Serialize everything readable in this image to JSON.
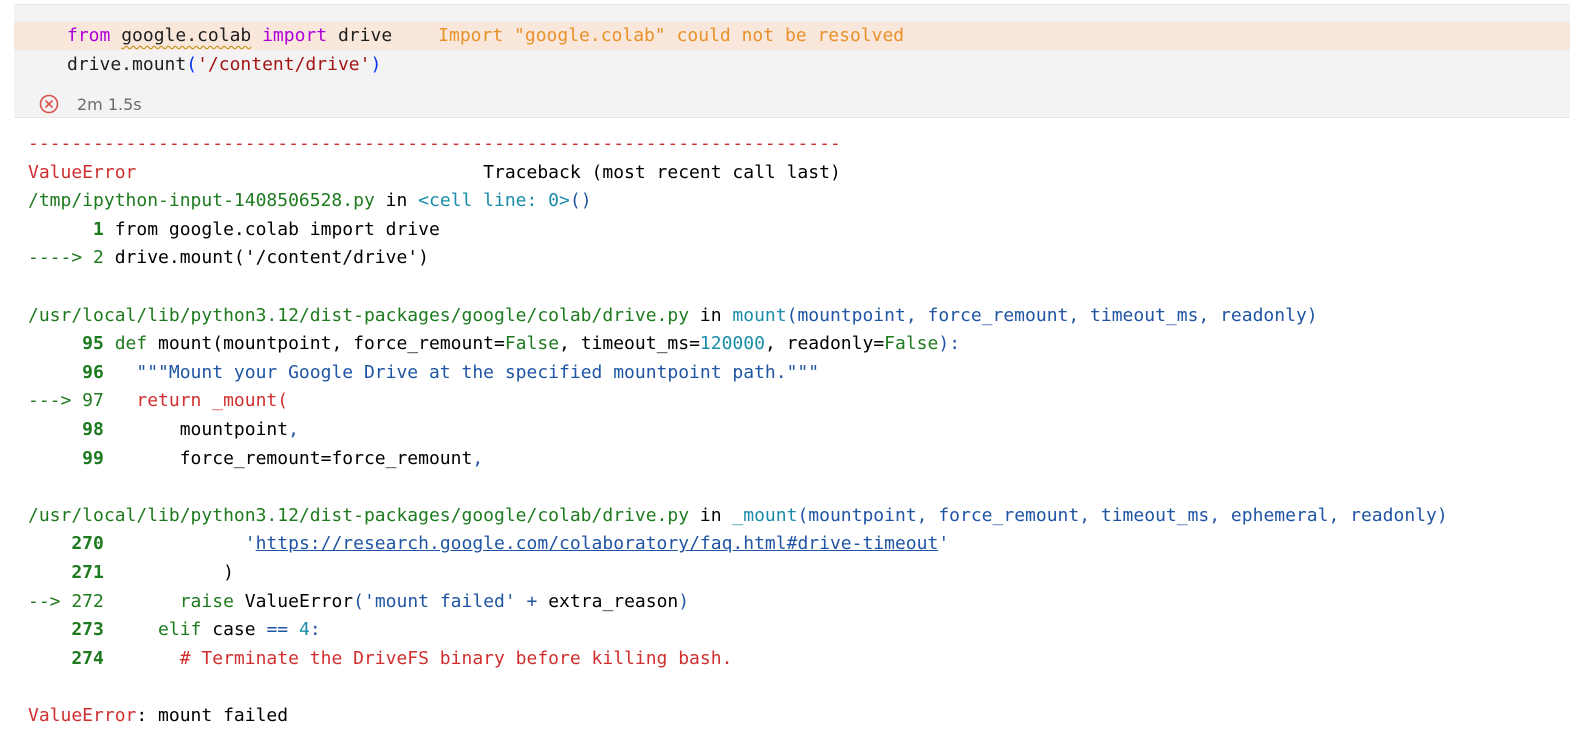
{
  "cell": {
    "line1": {
      "kw_from": "from",
      "module": "google.colab",
      "kw_import": "import",
      "name": "drive",
      "diagnostic": "Import \"google.colab\" could not be resolved"
    },
    "line2": {
      "call": "drive.mount",
      "paren_open": "(",
      "arg": "'/content/drive'",
      "paren_close": ")"
    },
    "status": {
      "icon": "error-circle-icon",
      "duration": "2m 1.5s"
    }
  },
  "output": {
    "separator": "---------------------------------------------------------------------------",
    "header": {
      "error": "ValueError",
      "traceback": "Traceback (most recent call last)"
    },
    "frame1": {
      "path": "/tmp/ipython-input-1408506528.py",
      "in_word": " in ",
      "location": "<cell line: 0>",
      "loc_parens": "()",
      "lines": [
        {
          "marker": "      1 ",
          "text": "from google.colab import drive"
        },
        {
          "marker": "----> 2 ",
          "text": "drive.mount('/content/drive')"
        }
      ]
    },
    "frame2": {
      "path": "/usr/local/lib/python3.12/dist-packages/google/colab/drive.py",
      "in_word": " in ",
      "func": "mount",
      "sig": "(mountpoint, force_remount, timeout_ms, readonly)",
      "lines": [
        {
          "marker": "     95 ",
          "kw": "def",
          "rest": " mount(mountpoint, force_remount=",
          "false1": "False",
          "mid": ", timeout_ms=",
          "num": "120000",
          "mid2": ", readonly=",
          "false2": "False",
          "end": "):"
        },
        {
          "marker": "     96 ",
          "text": "  \"\"\"Mount your Google Drive at the specified mountpoint path.\"\"\""
        },
        {
          "marker": "---> 97 ",
          "text": "  return _mount("
        },
        {
          "marker": "     98 ",
          "text": "      mountpoint",
          "comma": ","
        },
        {
          "marker": "     99 ",
          "text": "      force_remount=force_remount",
          "comma": ","
        }
      ]
    },
    "frame3": {
      "path": "/usr/local/lib/python3.12/dist-packages/google/colab/drive.py",
      "in_word": " in ",
      "func": "_mount",
      "sig": "(mountpoint, force_remount, timeout_ms, ephemeral, readonly)",
      "lines": [
        {
          "marker": "    270 ",
          "pre": "            '",
          "url": "https://research.google.com/colaboratory/faq.html#drive-timeout",
          "post": "'"
        },
        {
          "marker": "    271 ",
          "text": "          )"
        },
        {
          "marker": "--> 272 ",
          "kw": "      raise",
          "rest": " ValueError",
          "open": "(",
          "str": "'mount failed'",
          "op": " + ",
          "rest2": "extra_reason",
          "close": ")"
        },
        {
          "marker": "    273 ",
          "kw": "    elif",
          "rest": " case ",
          "op": "==",
          "num": " 4",
          "colon": ":"
        },
        {
          "marker": "    274 ",
          "text": "      # Terminate the DriveFS binary before killing bash."
        }
      ]
    },
    "final": {
      "error": "ValueError",
      "message": ": mount failed"
    }
  }
}
